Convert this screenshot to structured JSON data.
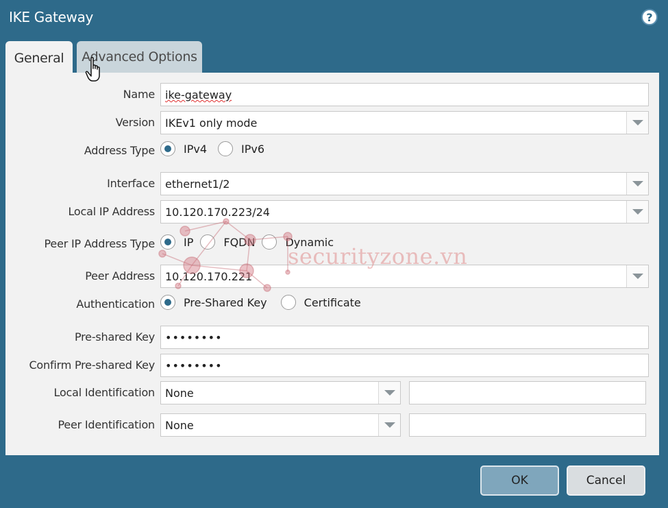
{
  "dialog": {
    "title": "IKE Gateway",
    "help_icon": "help-icon"
  },
  "tabs": [
    {
      "label": "General",
      "active": true
    },
    {
      "label": "Advanced Options",
      "active": false
    }
  ],
  "form": {
    "name": {
      "label": "Name",
      "value": "ike-gateway"
    },
    "version": {
      "label": "Version",
      "value": "IKEv1 only mode"
    },
    "address_type": {
      "label": "Address Type",
      "options": [
        "IPv4",
        "IPv6"
      ],
      "selected": "IPv4"
    },
    "interface": {
      "label": "Interface",
      "value": "ethernet1/2"
    },
    "local_ip": {
      "label": "Local IP Address",
      "value": "10.120.170.223/24"
    },
    "peer_ip_type": {
      "label": "Peer IP Address Type",
      "options": [
        "IP",
        "FQDN",
        "Dynamic"
      ],
      "selected": "IP"
    },
    "peer_address": {
      "label": "Peer Address",
      "value": "10.120.170.221"
    },
    "authentication": {
      "label": "Authentication",
      "options": [
        "Pre-Shared Key",
        "Certificate"
      ],
      "selected": "Pre-Shared Key"
    },
    "psk": {
      "label": "Pre-shared Key",
      "value": "••••••••"
    },
    "confirm_psk": {
      "label": "Confirm Pre-shared Key",
      "value": "••••••••"
    },
    "local_id": {
      "label": "Local Identification",
      "value": "None",
      "extra": ""
    },
    "peer_id": {
      "label": "Peer Identification",
      "value": "None",
      "extra": ""
    }
  },
  "watermark": "securityzone.vn",
  "buttons": {
    "ok": "OK",
    "cancel": "Cancel"
  },
  "colors": {
    "background": "#2e6a8a",
    "panel": "#f2f2f2",
    "ok_button": "#7fa6bc"
  }
}
